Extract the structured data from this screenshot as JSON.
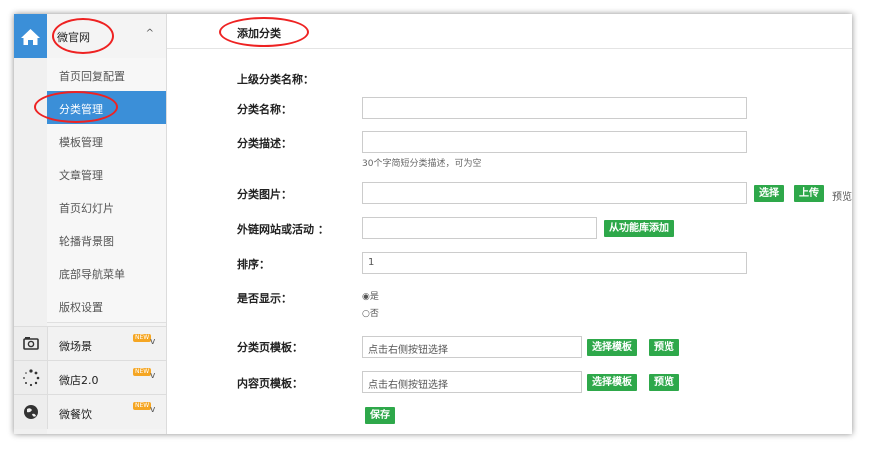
{
  "sidebar": {
    "section_title": "微官网",
    "sub_items": [
      {
        "label": "首页回复配置"
      },
      {
        "label": "分类管理"
      },
      {
        "label": "模板管理"
      },
      {
        "label": "文章管理"
      },
      {
        "label": "首页幻灯片"
      },
      {
        "label": "轮播背景图"
      },
      {
        "label": "底部导航菜单"
      },
      {
        "label": "版权设置"
      }
    ],
    "other_sections": [
      {
        "label": "微场景",
        "badge": "NEW"
      },
      {
        "label": "微店2.0",
        "badge": "NEW"
      },
      {
        "label": "微餐饮",
        "badge": "NEW"
      }
    ]
  },
  "page": {
    "title": "添加分类",
    "parent_label": "上级分类名称：",
    "name_label": "分类名称：",
    "desc_label": "分类描述：",
    "desc_hint": "30个字简短分类描述，可为空",
    "image_label": "分类图片：",
    "select_btn": "选择",
    "upload_btn": "上传",
    "preview_link": "预览",
    "link_label": "外链网站或活动 ：",
    "from_lib_btn": "从功能库添加",
    "sort_label": "排序：",
    "sort_value": "1",
    "show_label": "是否显示：",
    "show_yes": "是",
    "show_no": "否",
    "cat_tpl_label": "分类页模板：",
    "cat_tpl_value": "点击右侧按钮选择",
    "content_tpl_label": "内容页模板：",
    "content_tpl_value": "点击右侧按钮选择",
    "choose_tpl_btn": "选择模板",
    "preview_btn": "预览",
    "save_btn": "保存"
  },
  "colors": {
    "accent": "#3b8fd8",
    "button": "#2ea84a",
    "highlight": "#e22222",
    "badge": "#f5a623"
  }
}
